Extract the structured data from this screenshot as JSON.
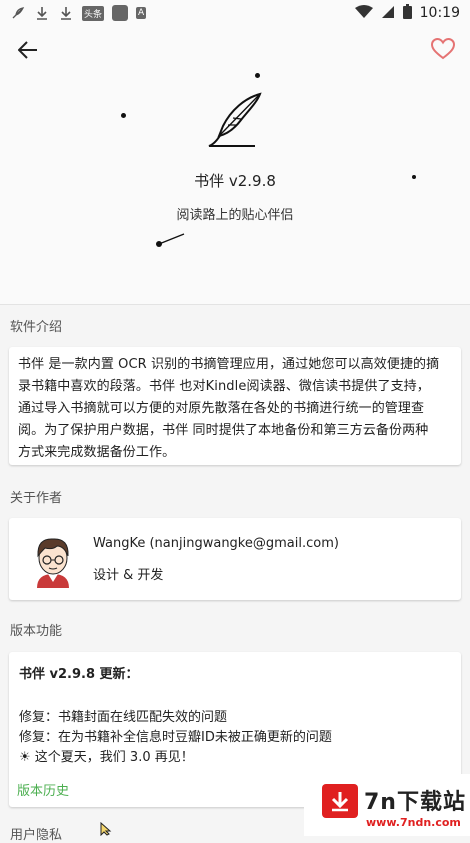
{
  "status_bar": {
    "time": "10:19",
    "left_icons": [
      "feather-icon",
      "download-icon",
      "download-icon",
      "app-badge-icon",
      "app-square-icon",
      "font-a-icon"
    ],
    "app_badge_text": "头条",
    "font_a_text": "A",
    "right_icons": [
      "wifi-icon",
      "signal-icon",
      "battery-icon"
    ]
  },
  "toolbar": {
    "back_icon": "arrow-left-icon",
    "favorite_icon": "heart-outline-icon",
    "favorite_color": "#e57373"
  },
  "app": {
    "logo_icon": "feather-quill-icon",
    "title": "书伴  v2.9.8",
    "tagline": "阅读路上的贴心伴侣"
  },
  "sections": {
    "intro_label": "软件介绍",
    "author_label": "关于作者",
    "version_label": "版本功能",
    "privacy_label": "用户隐私"
  },
  "intro": {
    "lines": [
      "书伴 是一款内置 OCR 识别的书摘管理应用，通过她您可以高效便捷的摘",
      "录书籍中喜欢的段落。书伴 也对Kindle阅读器、微信读书提供了支持，",
      "通过导入书摘就可以方便的对原先散落在各处的书摘进行统一的管理查",
      "阅。为了保护用户数据，书伴 同时提供了本地备份和第三方云备份两种",
      "方式来完成数据备份工作。"
    ]
  },
  "author": {
    "avatar_icon": "avatar-cartoon-icon",
    "name": "WangKe (nanjingwangke@gmail.com)",
    "role": "设计 & 开发"
  },
  "version": {
    "title": "书伴  v2.9.8 更新：",
    "lines": [
      "修复：书籍封面在线匹配失效的问题",
      "修复：在为书籍补全信息时豆瓣ID未被正确更新的问题",
      "☀ 这个夏天，我们 3.0 再见！"
    ],
    "history_link": "版本历史",
    "accent_color": "#4caf50"
  },
  "watermark": {
    "title": "7n下载站",
    "url": "www.7ndn.com",
    "icon": "download-arrow-icon",
    "color": "#e02020"
  }
}
